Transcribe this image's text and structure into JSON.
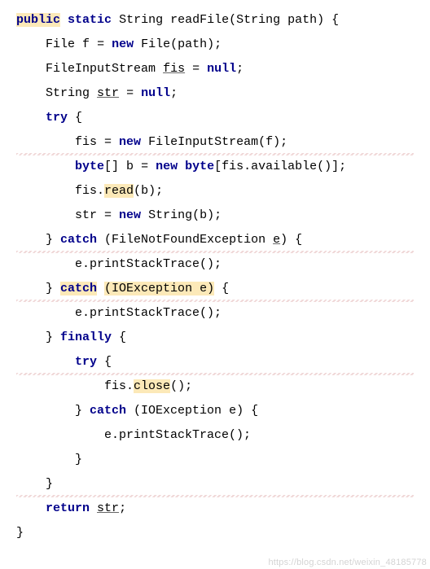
{
  "code": {
    "l1": {
      "public": "public",
      "static": "static",
      "ret": "String",
      "name": "readFile",
      "arg": "String path"
    },
    "l2": {
      "type": "File",
      "var": "f",
      "new": "new",
      "ctor": "File",
      "arg": "path"
    },
    "l3": {
      "type": "FileInputStream",
      "var": "fis",
      "nul": "null"
    },
    "l4": {
      "type": "String",
      "var": "str",
      "nul": "null"
    },
    "l5": {
      "try": "try"
    },
    "l6": {
      "var": "fis",
      "new": "new",
      "ctor": "FileInputStream",
      "arg": "f"
    },
    "l7": {
      "byte": "byte",
      "var": "b",
      "new": "new",
      "byte2": "byte",
      "expr": "fis.available()"
    },
    "l8": {
      "obj": "fis.",
      "read": "read",
      "arg": "b"
    },
    "l9": {
      "var": "str",
      "new": "new",
      "ctor": "String",
      "arg": "b"
    },
    "l10": {
      "catch": "catch",
      "type": "FileNotFoundException",
      "var": "e"
    },
    "l11": {
      "call": "e.printStackTrace();"
    },
    "l12": {
      "catch": "catch",
      "paren": "(IOException e)"
    },
    "l13": {
      "call": "e.printStackTrace();"
    },
    "l14": {
      "finally": "finally"
    },
    "l15": {
      "try": "try"
    },
    "l16": {
      "obj": "fis.",
      "close": "close",
      "rest": "();"
    },
    "l17": {
      "catch": "catch",
      "type": "IOException",
      "var": "e"
    },
    "l18": {
      "call": "e.printStackTrace();"
    },
    "l19": {
      "brace": "}"
    },
    "l20": {
      "brace": "}"
    },
    "l21": {
      "return": "return",
      "var": "str"
    },
    "l22": {
      "brace": "}"
    }
  },
  "watermark": "https://blog.csdn.net/weixin_48185778"
}
